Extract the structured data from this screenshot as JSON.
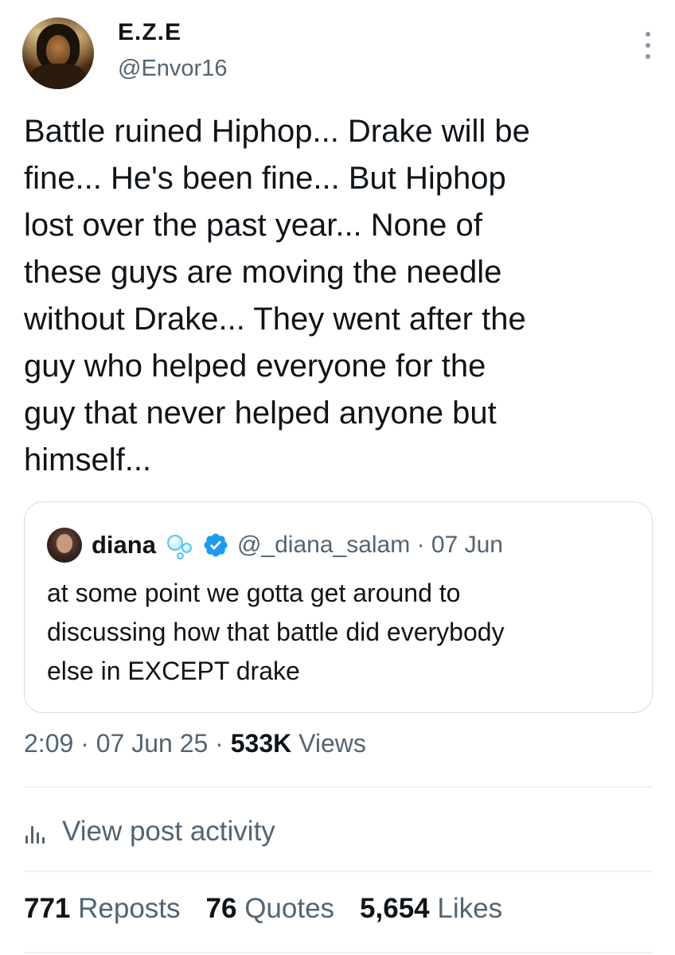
{
  "author": {
    "name": "E.Z.E",
    "handle": "@Envor16"
  },
  "tweet": {
    "text": "Battle ruined Hiphop... Drake will be\nfine... He's been fine... But Hiphop\nlost over the past year... None of\nthese guys are moving the needle\nwithout Drake... They went after the\nguy who helped everyone for the\nguy that never helped anyone but\nhimself..."
  },
  "quote": {
    "name": "diana",
    "handle_time": "@_diana_salam · 07 Jun",
    "text": "at some point we gotta get around to\ndiscussing how that battle did everybody\nelse in EXCEPT drake",
    "icons": [
      "bubbles-emoji-icon",
      "verified-badge-icon"
    ]
  },
  "meta": {
    "time": "2:09",
    "sep1": " · ",
    "date": "07 Jun 25",
    "sep2": " · ",
    "views_count": "533K",
    "views_label": " Views"
  },
  "activity": {
    "label": "View post activity",
    "icon": "analytics-bars-icon"
  },
  "stats": {
    "reposts_count": "771",
    "reposts_label": " Reposts",
    "quotes_count": "76",
    "quotes_label": " Quotes",
    "likes_count": "5,654",
    "likes_label": " Likes"
  },
  "colors": {
    "text_primary": "#0f1419",
    "text_secondary": "#536471",
    "verified": "#1d9bf0",
    "border": "#d7dde2"
  }
}
